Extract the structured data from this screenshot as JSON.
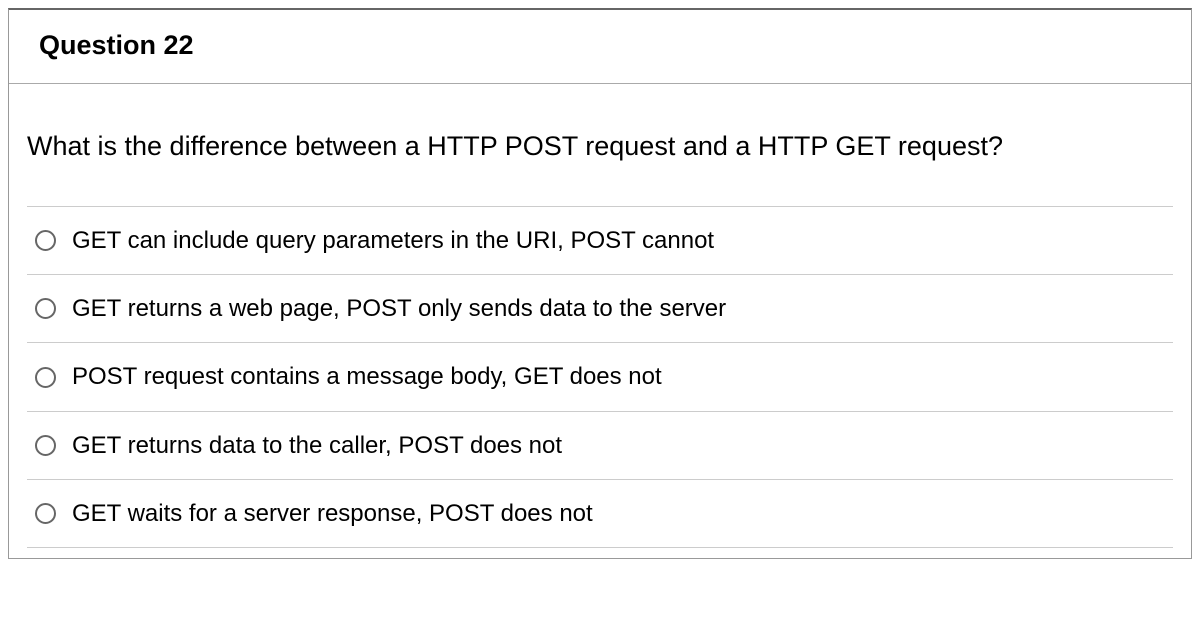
{
  "question": {
    "title": "Question 22",
    "prompt": "What is the difference between a HTTP POST request and a HTTP GET request?",
    "options": [
      {
        "label": "GET can include query parameters in the URI, POST cannot"
      },
      {
        "label": "GET returns a web page, POST only sends data to the server"
      },
      {
        "label": "POST request contains a message body, GET does not"
      },
      {
        "label": "GET returns data to the caller, POST does not"
      },
      {
        "label": "GET waits for a server response, POST does not"
      }
    ]
  }
}
